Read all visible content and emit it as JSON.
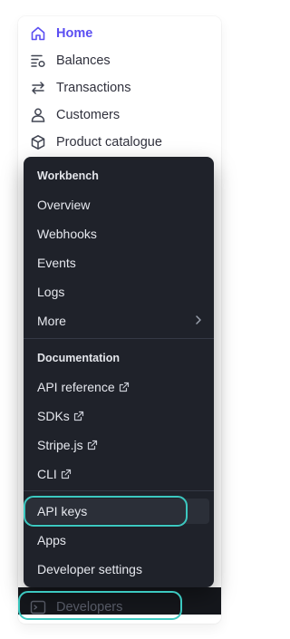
{
  "nav": {
    "items": [
      {
        "label": "Home",
        "icon": "home-icon",
        "active": true
      },
      {
        "label": "Balances",
        "icon": "balances-icon"
      },
      {
        "label": "Transactions",
        "icon": "transactions-icon"
      },
      {
        "label": "Customers",
        "icon": "customers-icon"
      },
      {
        "label": "Product catalogue",
        "icon": "product-icon"
      }
    ]
  },
  "flyout": {
    "workbench_title": "Workbench",
    "workbench_items": [
      {
        "label": "Overview"
      },
      {
        "label": "Webhooks"
      },
      {
        "label": "Events"
      },
      {
        "label": "Logs"
      },
      {
        "label": "More"
      }
    ],
    "documentation_title": "Documentation",
    "documentation_items": [
      {
        "label": "API reference"
      },
      {
        "label": "SDKs"
      },
      {
        "label": "Stripe.js"
      },
      {
        "label": "CLI"
      }
    ],
    "settings_items": [
      {
        "label": "API keys"
      },
      {
        "label": "Apps"
      },
      {
        "label": "Developer settings"
      }
    ]
  },
  "developers": {
    "label": "Developers",
    "icon": "terminal-icon"
  },
  "colors": {
    "accent": "#5b4ef2",
    "menu_bg": "#1f222a",
    "focus_ring": "#3cc8c0"
  }
}
